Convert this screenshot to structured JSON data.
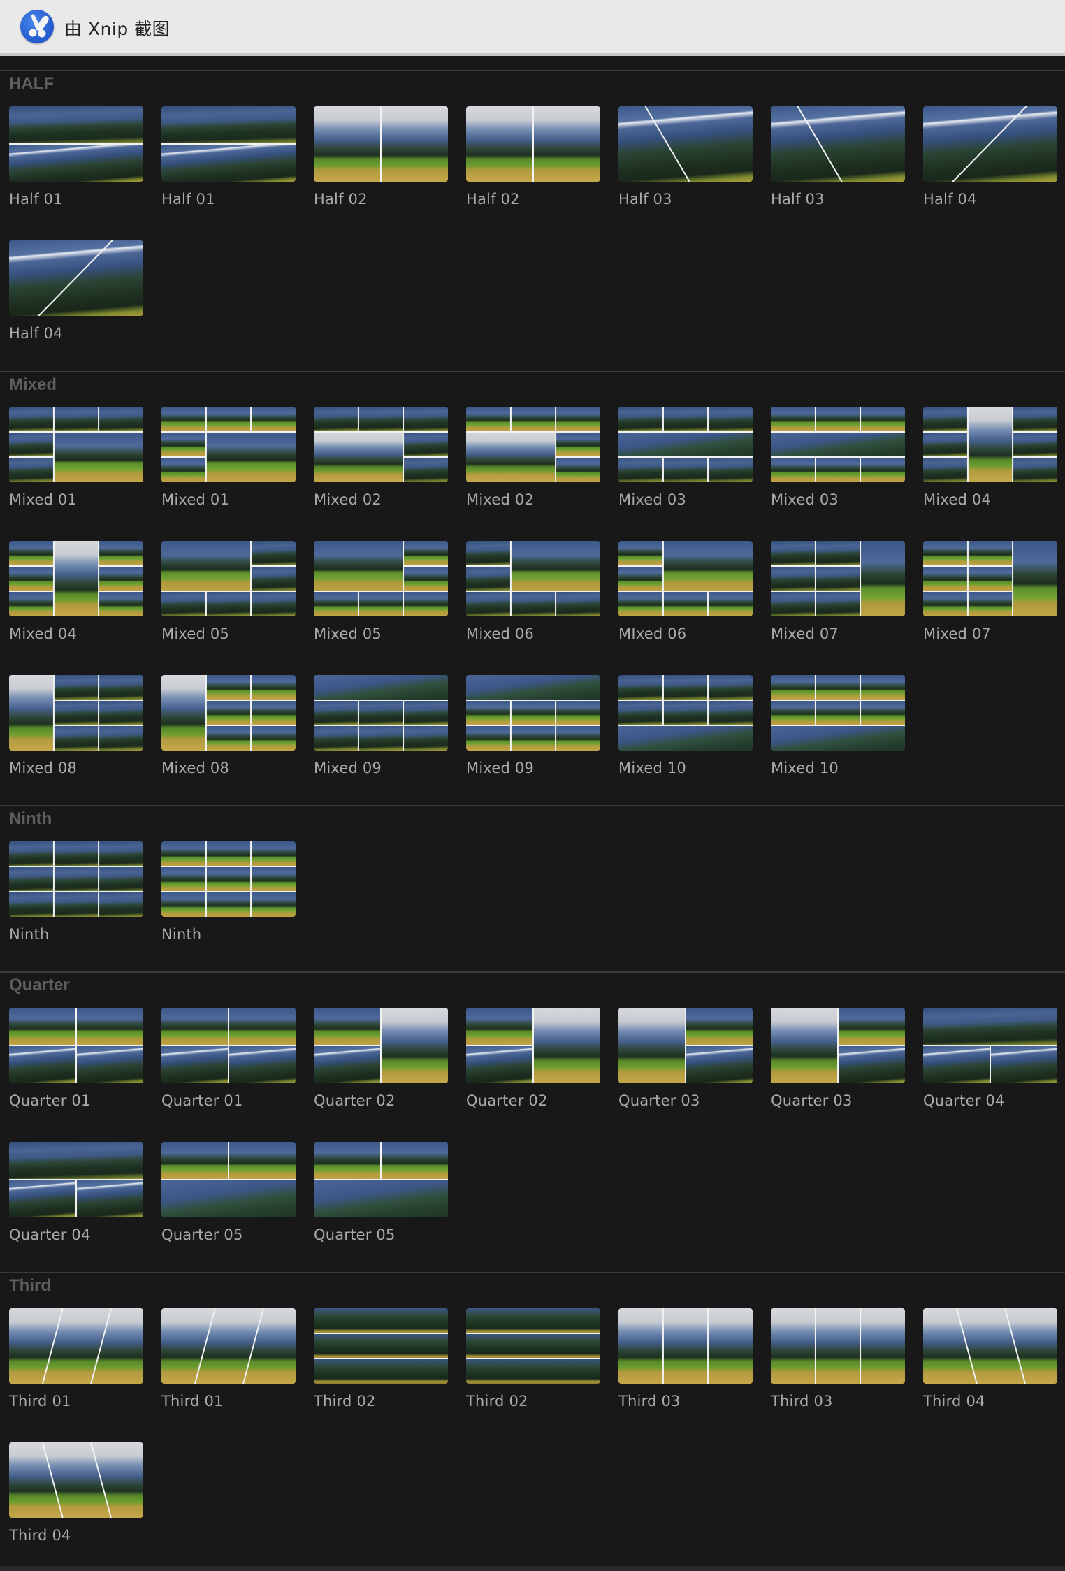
{
  "window": {
    "title": "由 Xnip 截图",
    "app_icon": "xnip-scissors-icon"
  },
  "colors": {
    "background": "#181818",
    "titlebar": "#e9e9e9",
    "section_title": "#5e5e5e",
    "label": "#a9a9a9",
    "divider": "#3a3a3a",
    "split_line": "#f2f2f2"
  },
  "sections": [
    {
      "title": "HALF",
      "items": [
        {
          "label": "Half 01",
          "layout": "h2",
          "variant": "a"
        },
        {
          "label": "Half 01",
          "layout": "h2",
          "variant": "b"
        },
        {
          "label": "Half 02",
          "layout": "v2",
          "variant": "a"
        },
        {
          "label": "Half 02",
          "layout": "v2",
          "variant": "b"
        },
        {
          "label": "Half 03",
          "layout": "diag-down",
          "variant": "a"
        },
        {
          "label": "Half 03",
          "layout": "diag-down",
          "variant": "b"
        },
        {
          "label": "Half 04",
          "layout": "diag-up",
          "variant": "a"
        },
        {
          "label": "Half 04",
          "layout": "diag-up",
          "variant": "b"
        }
      ]
    },
    {
      "title": "Mixed",
      "items": [
        {
          "label": "Mixed 01",
          "layout": "m01",
          "variant": "a"
        },
        {
          "label": "Mixed 01",
          "layout": "m01",
          "variant": "b"
        },
        {
          "label": "Mixed 02",
          "layout": "m02",
          "variant": "a"
        },
        {
          "label": "Mixed 02",
          "layout": "m02",
          "variant": "b"
        },
        {
          "label": "Mixed 03",
          "layout": "m03",
          "variant": "a"
        },
        {
          "label": "Mixed 03",
          "layout": "m03",
          "variant": "b"
        },
        {
          "label": "Mixed 04",
          "layout": "m04",
          "variant": "a"
        },
        {
          "label": "Mixed 04",
          "layout": "m04",
          "variant": "b"
        },
        {
          "label": "Mixed 05",
          "layout": "m05",
          "variant": "a"
        },
        {
          "label": "Mixed 05",
          "layout": "m05",
          "variant": "b"
        },
        {
          "label": "Mixed 06",
          "layout": "m06",
          "variant": "a"
        },
        {
          "label": "MIxed 06",
          "layout": "m06",
          "variant": "b"
        },
        {
          "label": "Mixed 07",
          "layout": "m07",
          "variant": "a"
        },
        {
          "label": "Mixed 07",
          "layout": "m07",
          "variant": "b"
        },
        {
          "label": "Mixed 08",
          "layout": "m08",
          "variant": "a"
        },
        {
          "label": "Mixed 08",
          "layout": "m08",
          "variant": "b"
        },
        {
          "label": "Mixed 09",
          "layout": "m09",
          "variant": "a"
        },
        {
          "label": "Mixed 09",
          "layout": "m09",
          "variant": "b"
        },
        {
          "label": "Mixed 10",
          "layout": "m10",
          "variant": "a"
        },
        {
          "label": "Mixed 10",
          "layout": "m10",
          "variant": "b"
        }
      ]
    },
    {
      "title": "Ninth",
      "items": [
        {
          "label": "Ninth",
          "layout": "g9",
          "variant": "a"
        },
        {
          "label": "Ninth",
          "layout": "g9",
          "variant": "b"
        }
      ]
    },
    {
      "title": "Quarter",
      "items": [
        {
          "label": "Quarter 01",
          "layout": "g4",
          "variant": "a"
        },
        {
          "label": "Quarter 01",
          "layout": "g4",
          "variant": "b"
        },
        {
          "label": "Quarter 02",
          "layout": "q02",
          "variant": "a"
        },
        {
          "label": "Quarter 02",
          "layout": "q02",
          "variant": "b"
        },
        {
          "label": "Quarter 03",
          "layout": "q03",
          "variant": "a"
        },
        {
          "label": "Quarter 03",
          "layout": "q03",
          "variant": "b"
        },
        {
          "label": "Quarter 04",
          "layout": "q04",
          "variant": "a"
        },
        {
          "label": "Quarter 04",
          "layout": "q04",
          "variant": "b"
        },
        {
          "label": "Quarter 05",
          "layout": "q05",
          "variant": "a"
        },
        {
          "label": "Quarter 05",
          "layout": "q05",
          "variant": "b"
        }
      ]
    },
    {
      "title": "Third",
      "items": [
        {
          "label": "Third 01",
          "layout": "t01",
          "variant": "a"
        },
        {
          "label": "Third 01",
          "layout": "t01",
          "variant": "b"
        },
        {
          "label": "Third 02",
          "layout": "t02",
          "variant": "a"
        },
        {
          "label": "Third 02",
          "layout": "t02",
          "variant": "b"
        },
        {
          "label": "Third 03",
          "layout": "t03",
          "variant": "a"
        },
        {
          "label": "Third 03",
          "layout": "t03",
          "variant": "b"
        },
        {
          "label": "Third 04",
          "layout": "t04",
          "variant": "a"
        },
        {
          "label": "Third 04",
          "layout": "t04",
          "variant": "b"
        }
      ]
    }
  ]
}
